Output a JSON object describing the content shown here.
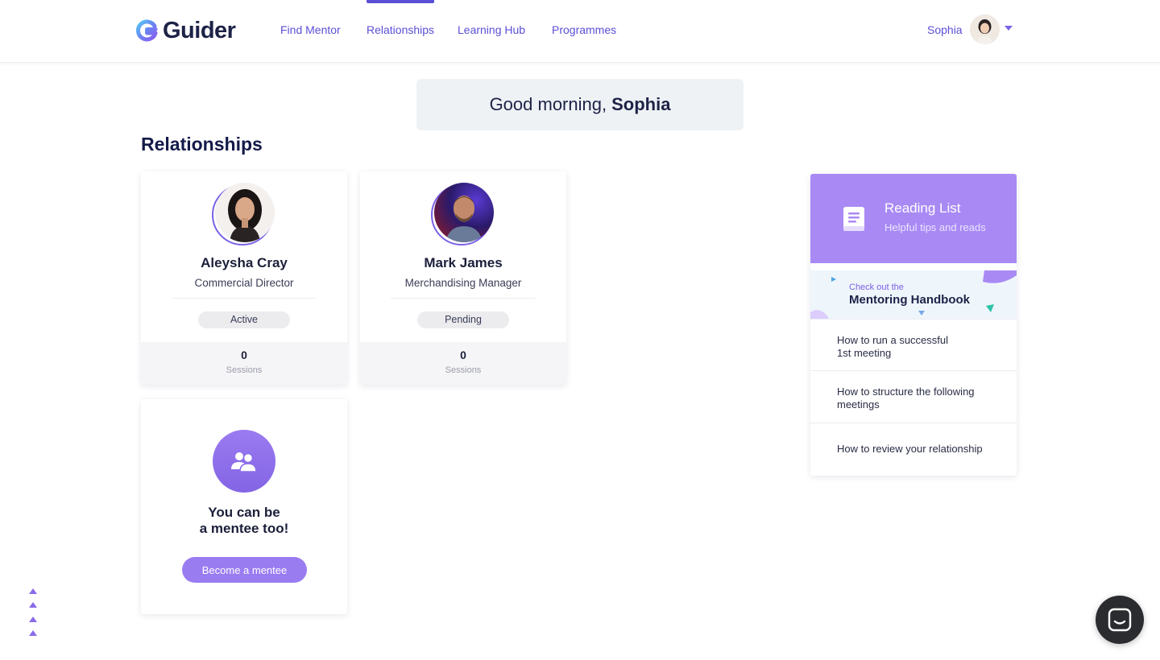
{
  "brand": {
    "name": "Guider"
  },
  "nav": {
    "items": [
      {
        "label": "Find Mentor"
      },
      {
        "label": "Relationships",
        "active": true
      },
      {
        "label": "Learning Hub"
      },
      {
        "label": "Programmes"
      }
    ],
    "user_name": "Sophia"
  },
  "greeting": {
    "prefix": "Good morning,",
    "name": "Sophia"
  },
  "relationships": {
    "title": "Relationships",
    "cards": [
      {
        "name": "Aleysha Cray",
        "role": "Commercial Director",
        "status": "Active",
        "sessions": "0",
        "sessions_label": "Sessions"
      },
      {
        "name": "Mark James",
        "role": "Merchandising Manager",
        "status": "Pending",
        "sessions": "0",
        "sessions_label": "Sessions"
      }
    ],
    "mentee": {
      "line1": "You can be",
      "line2": "a mentee too!",
      "button": "Become a mentee"
    }
  },
  "reading_list": {
    "title": "Reading List",
    "subtitle": "Helpful tips and reads",
    "handbook": {
      "small": "Check out the",
      "big": "Mentoring Handbook"
    },
    "items": [
      {
        "line1": "How to run a successful",
        "line2": "1st meeting"
      },
      {
        "line1": "How to structure the following",
        "line2": "meetings"
      },
      {
        "line1": "How to review your relationship",
        "line2": ""
      }
    ]
  },
  "colors": {
    "accent": "#5b4fd6",
    "accent_light": "#a98af4",
    "button": "#9a7cf1"
  }
}
